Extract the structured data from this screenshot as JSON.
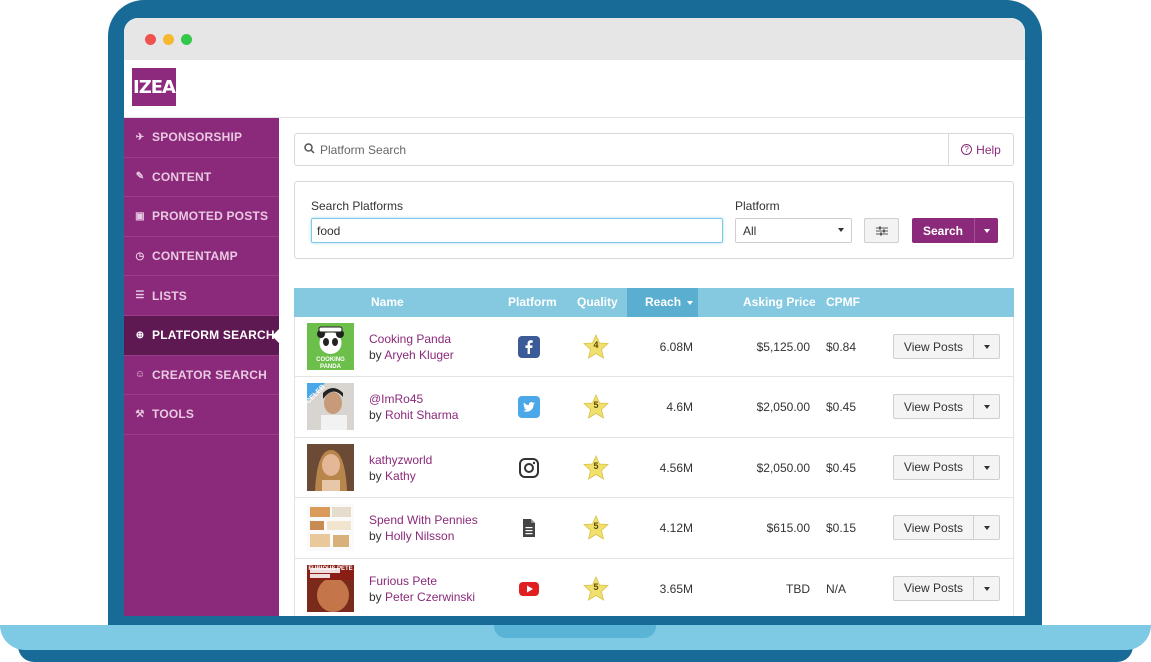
{
  "app": {
    "logo_text": "IZEA"
  },
  "colors": {
    "brand_purple": "#8b2a7a",
    "active_nav": "#5e1852",
    "table_header": "#84c9e0",
    "laptop_frame": "#176b96",
    "star": "#f1df6e"
  },
  "sidebar": {
    "items": [
      {
        "label": "SPONSORSHIP",
        "icon": "megaphone-icon",
        "glyph": "✈",
        "active": false
      },
      {
        "label": "CONTENT",
        "icon": "pencil-icon",
        "glyph": "✎",
        "active": false
      },
      {
        "label": "PROMOTED POSTS",
        "icon": "promote-icon",
        "glyph": "▣",
        "active": false
      },
      {
        "label": "CONTENTAMP",
        "icon": "clock-icon",
        "glyph": "◷",
        "active": false
      },
      {
        "label": "LISTS",
        "icon": "list-icon",
        "glyph": "☰",
        "active": false
      },
      {
        "label": "PLATFORM SEARCH",
        "icon": "search-icon",
        "glyph": "⊕",
        "active": true
      },
      {
        "label": "CREATOR SEARCH",
        "icon": "user-search-icon",
        "glyph": "☺",
        "active": false
      },
      {
        "label": "TOOLS",
        "icon": "wrench-icon",
        "glyph": "⚒",
        "active": false
      }
    ]
  },
  "platform_search": {
    "placeholder": "Platform Search",
    "help_label": "Help"
  },
  "search_panel": {
    "search_label": "Search Platforms",
    "search_value": "food",
    "platform_label": "Platform",
    "platform_value": "All",
    "search_button": "Search"
  },
  "table": {
    "headers": {
      "name": "Name",
      "platform": "Platform",
      "quality": "Quality",
      "reach": "Reach",
      "asking_price": "Asking Price",
      "cpmf": "CPMF"
    },
    "sorted_by": "Reach",
    "rows": [
      {
        "handle": "Cooking Panda",
        "by": "by",
        "creator": "Aryeh Kluger",
        "platform": "facebook",
        "quality": "4",
        "reach": "6.08M",
        "asking_price": "$5,125.00",
        "cpmf": "$0.84",
        "action": "View Posts",
        "thumb_text": "COOKING PANDA",
        "badge": ""
      },
      {
        "handle": "@ImRo45",
        "by": "by",
        "creator": "Rohit Sharma",
        "platform": "twitter",
        "quality": "5",
        "reach": "4.6M",
        "asking_price": "$2,050.00",
        "cpmf": "$0.45",
        "action": "View Posts",
        "thumb_text": "",
        "badge": "CELEB"
      },
      {
        "handle": "kathyzworld",
        "by": "by",
        "creator": "Kathy",
        "platform": "instagram",
        "quality": "5",
        "reach": "4.56M",
        "asking_price": "$2,050.00",
        "cpmf": "$0.45",
        "action": "View Posts",
        "thumb_text": "",
        "badge": ""
      },
      {
        "handle": "Spend With Pennies",
        "by": "by",
        "creator": "Holly Nilsson",
        "platform": "blog",
        "quality": "5",
        "reach": "4.12M",
        "asking_price": "$615.00",
        "cpmf": "$0.15",
        "action": "View Posts",
        "thumb_text": "",
        "badge": ""
      },
      {
        "handle": "Furious Pete",
        "by": "by",
        "creator": "Peter Czerwinski",
        "platform": "youtube",
        "quality": "5",
        "reach": "3.65M",
        "asking_price": "TBD",
        "cpmf": "N/A",
        "action": "View Posts",
        "thumb_text": "FURIOUS PETE",
        "badge": ""
      }
    ]
  }
}
